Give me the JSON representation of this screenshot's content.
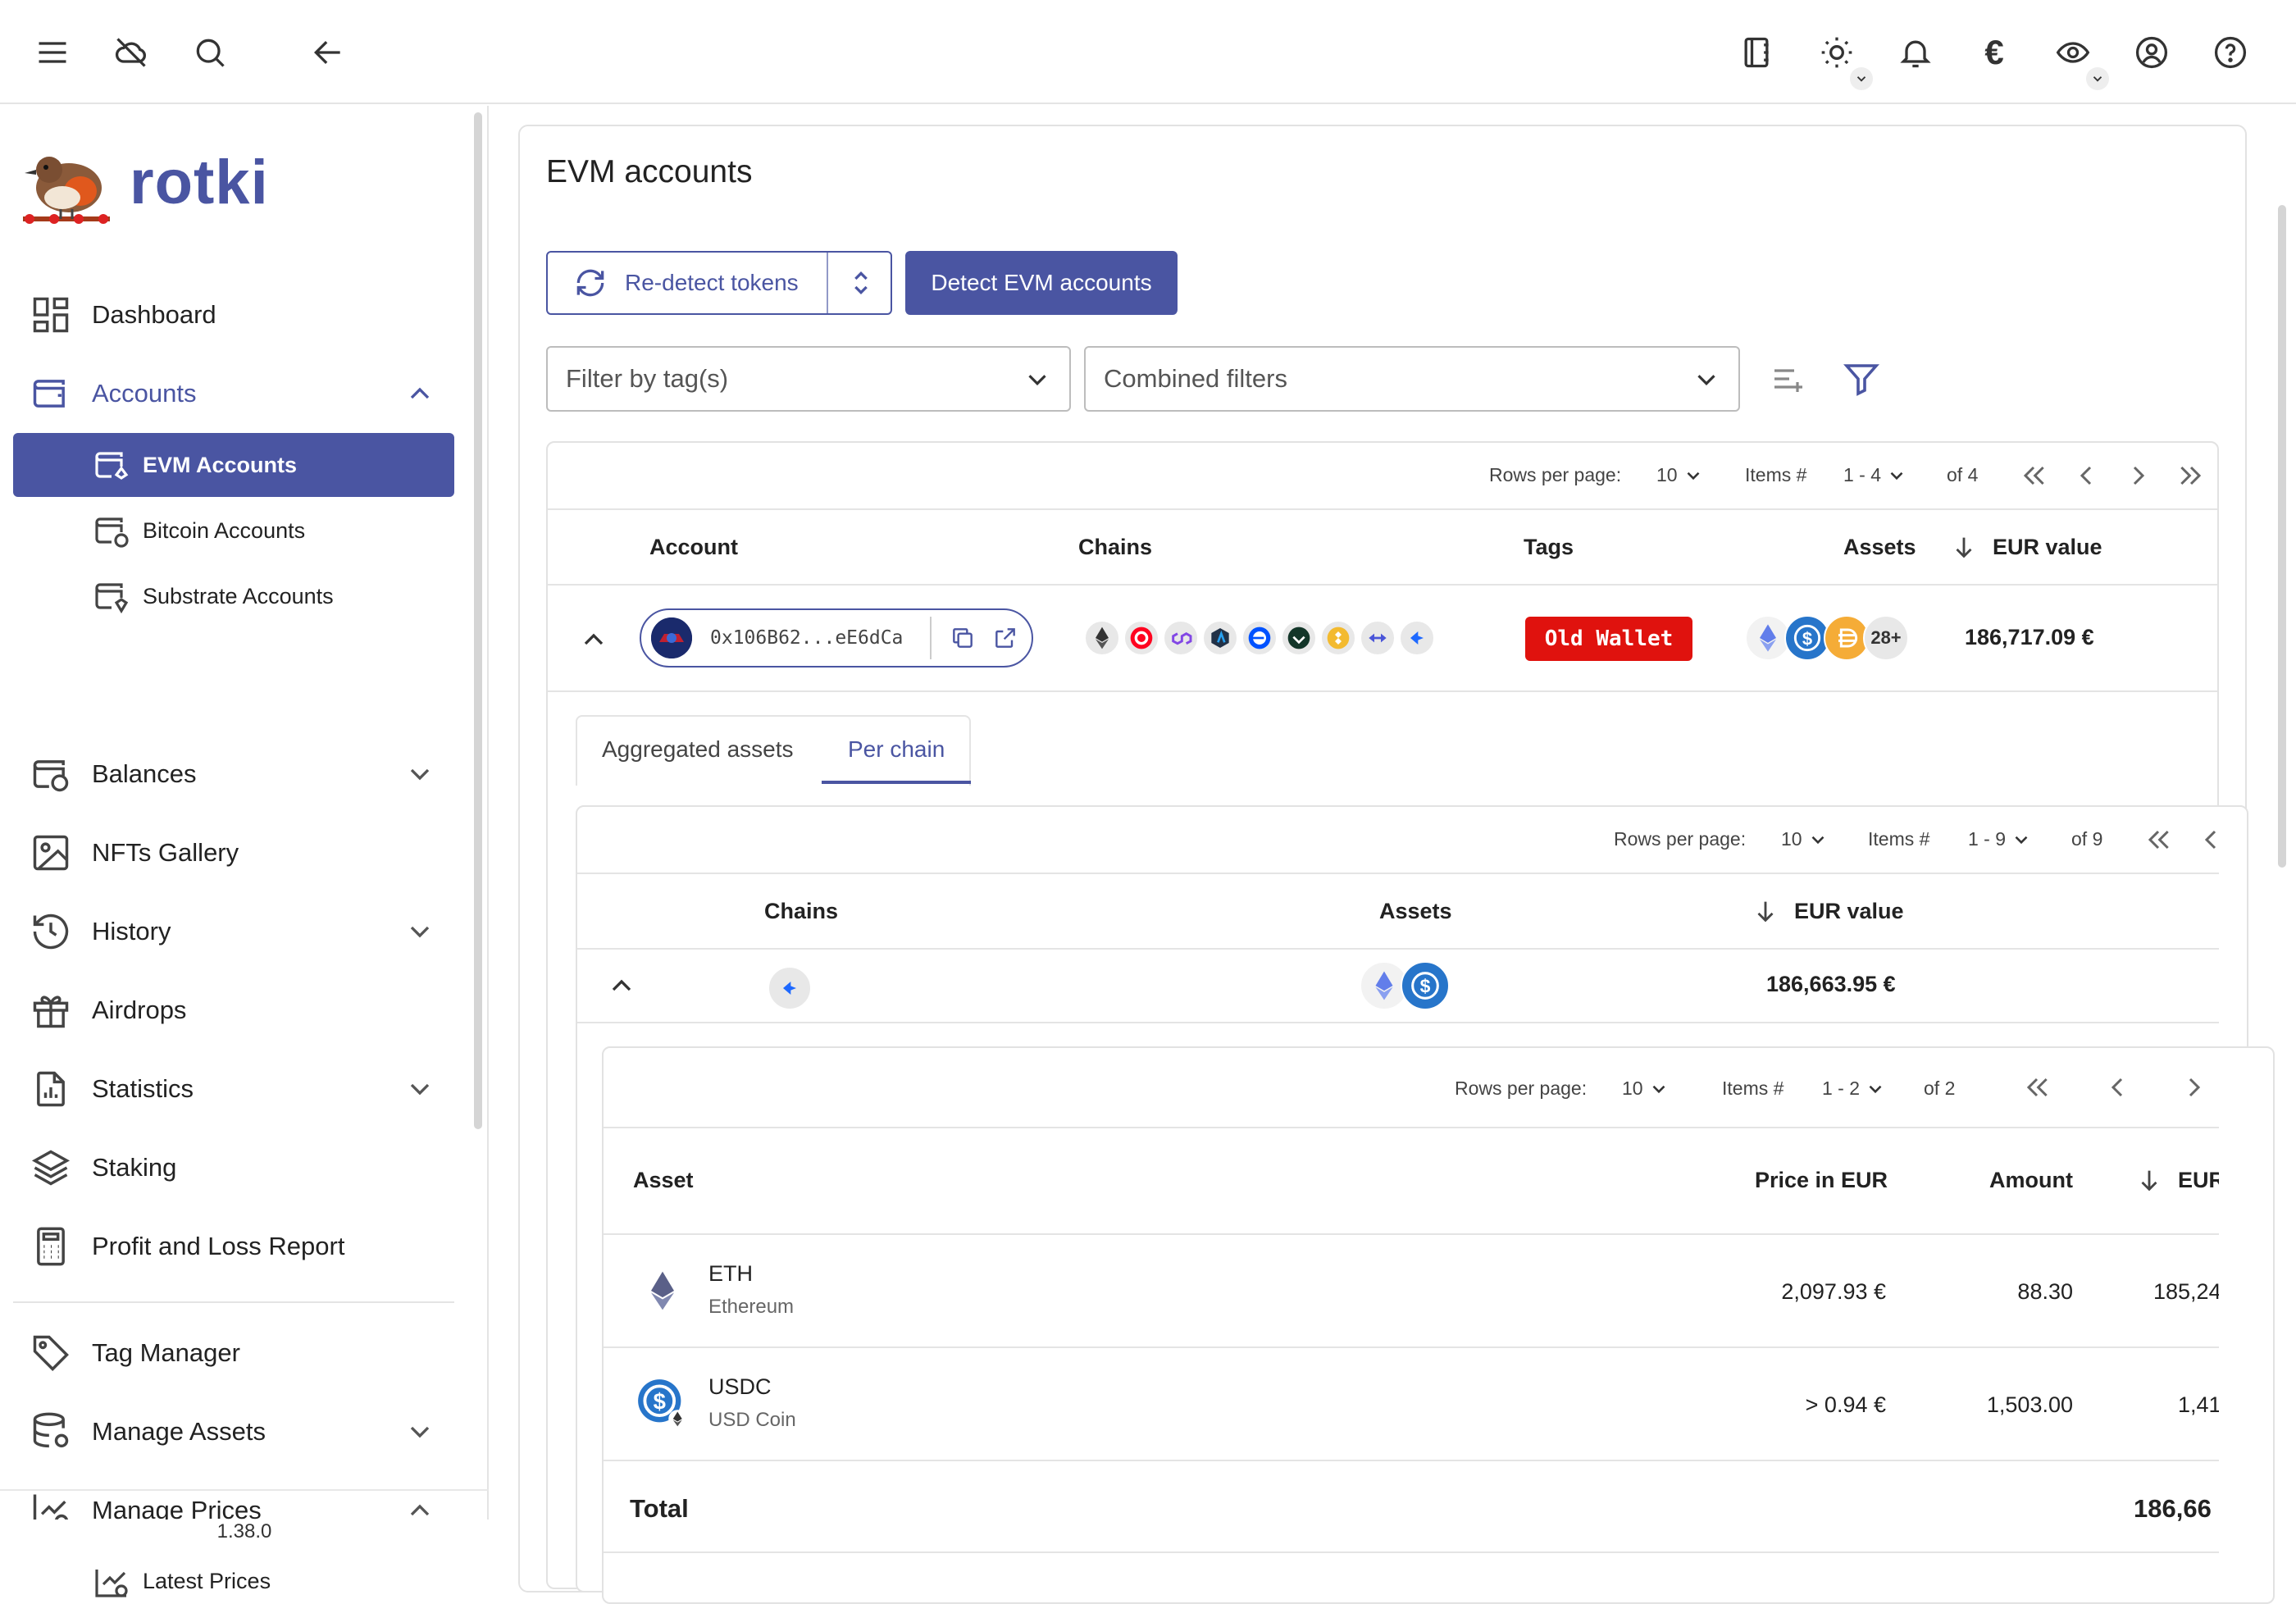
{
  "app": {
    "name": "rotki",
    "version": "1.38.0"
  },
  "topbar": {
    "currency_symbol": "€"
  },
  "sidebar": {
    "items": [
      {
        "label": "Dashboard"
      },
      {
        "label": "Accounts"
      },
      {
        "label": "EVM Accounts"
      },
      {
        "label": "Bitcoin Accounts"
      },
      {
        "label": "Substrate Accounts"
      },
      {
        "label": "Balances"
      },
      {
        "label": "NFTs Gallery"
      },
      {
        "label": "History"
      },
      {
        "label": "Airdrops"
      },
      {
        "label": "Statistics"
      },
      {
        "label": "Staking"
      },
      {
        "label": "Profit and Loss Report"
      },
      {
        "label": "Tag Manager"
      },
      {
        "label": "Manage Assets"
      },
      {
        "label": "Manage Prices"
      },
      {
        "label": "Latest Prices"
      }
    ]
  },
  "main": {
    "title": "EVM accounts",
    "redetect_label": "Re-detect tokens",
    "detect_label": "Detect EVM accounts",
    "filter_tag_placeholder": "Filter by tag(s)",
    "combined_filters_placeholder": "Combined filters",
    "accounts_table": {
      "pagination": {
        "rows_label": "Rows per page:",
        "rows": "10",
        "items_label": "Items #",
        "range": "1 - 4",
        "of": "of 4"
      },
      "headers": {
        "account": "Account",
        "chains": "Chains",
        "tags": "Tags",
        "assets": "Assets",
        "value": "EUR value"
      },
      "row": {
        "address": "0x106B62...eE6dCa",
        "tag": "Old Wallet",
        "more_assets": "28+",
        "value": "186,717.09 €"
      }
    },
    "tabs": {
      "aggregated": "Aggregated assets",
      "per_chain": "Per chain"
    },
    "chain_table": {
      "pagination": {
        "rows_label": "Rows per page:",
        "rows": "10",
        "items_label": "Items #",
        "range": "1 - 9",
        "of": "of 9"
      },
      "headers": {
        "chains": "Chains",
        "assets": "Assets",
        "value": "EUR value"
      },
      "row": {
        "value": "186,663.95 €"
      }
    },
    "asset_table": {
      "pagination": {
        "rows_label": "Rows per page:",
        "rows": "10",
        "items_label": "Items #",
        "range": "1 - 2",
        "of": "of 2"
      },
      "headers": {
        "asset": "Asset",
        "price": "Price in EUR",
        "amount": "Amount",
        "value": "EUR"
      },
      "rows": [
        {
          "symbol": "ETH",
          "name": "Ethereum",
          "price": "2,097.93 €",
          "amount": "88.30",
          "value": "185,24"
        },
        {
          "symbol": "USDC",
          "name": "USD Coin",
          "price": "> 0.94 €",
          "amount": "1,503.00",
          "value": "1,41"
        }
      ],
      "total_label": "Total",
      "total_value": "186,66"
    }
  },
  "colors": {
    "primary": "#4a55a2",
    "tag_red": "#e0120e"
  }
}
